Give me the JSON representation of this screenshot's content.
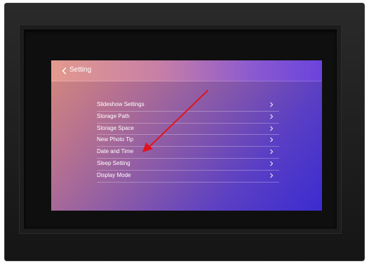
{
  "header": {
    "title": "Setting",
    "back_icon": "chevron-left-icon"
  },
  "menu": {
    "items": [
      {
        "label": "Slideshow Settings",
        "icon": "chevron-right-icon"
      },
      {
        "label": "Storage Path",
        "icon": "chevron-right-icon"
      },
      {
        "label": "Storage Space",
        "icon": "chevron-right-icon"
      },
      {
        "label": "New Photo Tip",
        "icon": "chevron-right-icon"
      },
      {
        "label": "Date and Time",
        "icon": "chevron-right-icon"
      },
      {
        "label": "Sleep Setting",
        "icon": "chevron-right-icon"
      },
      {
        "label": "Display Mode",
        "icon": "chevron-right-icon"
      }
    ]
  },
  "annotation": {
    "arrow_color": "#e0141e",
    "points_to": "Date and Time"
  },
  "colors": {
    "frame": "#1b1b1b",
    "text": "#ffffff"
  }
}
